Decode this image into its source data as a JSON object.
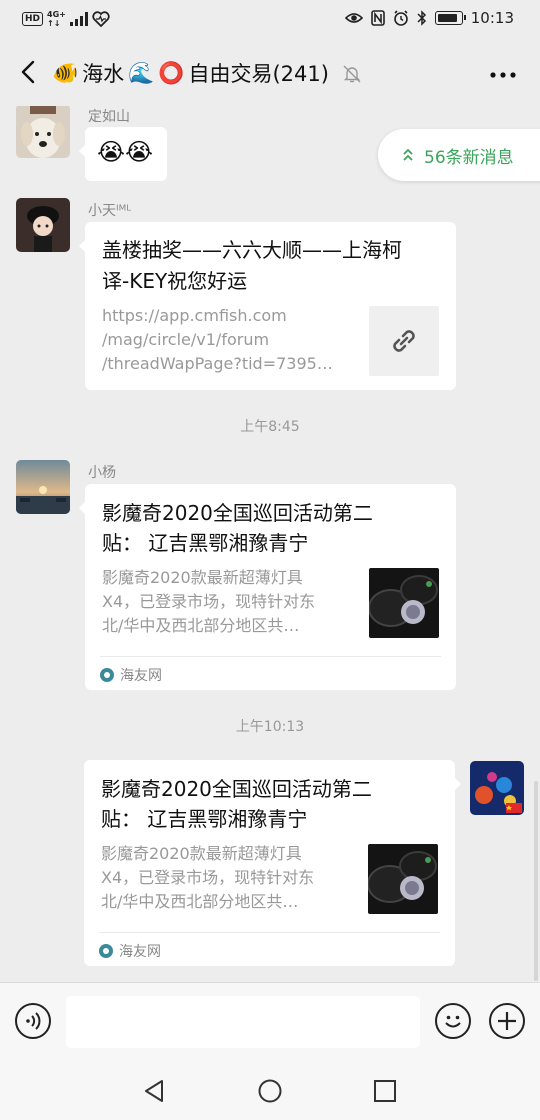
{
  "status_bar": {
    "hd": "HD",
    "net_top": "4G+",
    "net_bottom": "↑↓",
    "time": "10:13",
    "battery_level": 0.85
  },
  "nav": {
    "title_emoji1": "🐠",
    "title_part1": "海水",
    "title_emoji2": "🌊",
    "title_emoji3": "⭕",
    "title_part2": "自由交易(241)"
  },
  "new_messages": "56条新消息",
  "messages": [
    {
      "sender": "定如山",
      "text": "😭😭"
    },
    {
      "sender": "小天ᴵᴹᴸ",
      "card_title": "盖楼抽奖——六六大顺——上海柯译-KEY祝您好运",
      "card_title_line1": "盖楼抽奖——六六大顺——上海柯",
      "card_title_line2": "译-KEY祝您好运",
      "card_desc_line1": "https://app.cmfish.com",
      "card_desc_line2": "/mag/circle/v1/forum",
      "card_desc_line3": "/threadWapPage?tid=7395…"
    },
    {
      "timestamp": "上午8:45"
    },
    {
      "sender": "小杨",
      "card_title_line1": "影魔奇2020全国巡回活动第二",
      "card_title_line2": "贴：  辽吉黑鄂湘豫青宁",
      "card_desc_line1": "影魔奇2020款最新超薄灯具",
      "card_desc_line2": "X4，已登录市场，现特针对东",
      "card_desc_line3": "北/华中及西北部分地区共…",
      "source": "海友网"
    },
    {
      "timestamp": "上午10:13"
    },
    {
      "card_title_line1": "影魔奇2020全国巡回活动第二",
      "card_title_line2": "贴：  辽吉黑鄂湘豫青宁",
      "card_desc_line1": "影魔奇2020款最新超薄灯具",
      "card_desc_line2": "X4，已登录市场，现特针对东",
      "card_desc_line3": "北/华中及西北部分地区共…",
      "source": "海友网"
    }
  ],
  "colors": {
    "accent_green": "#3aa55a",
    "background": "#ededed"
  }
}
